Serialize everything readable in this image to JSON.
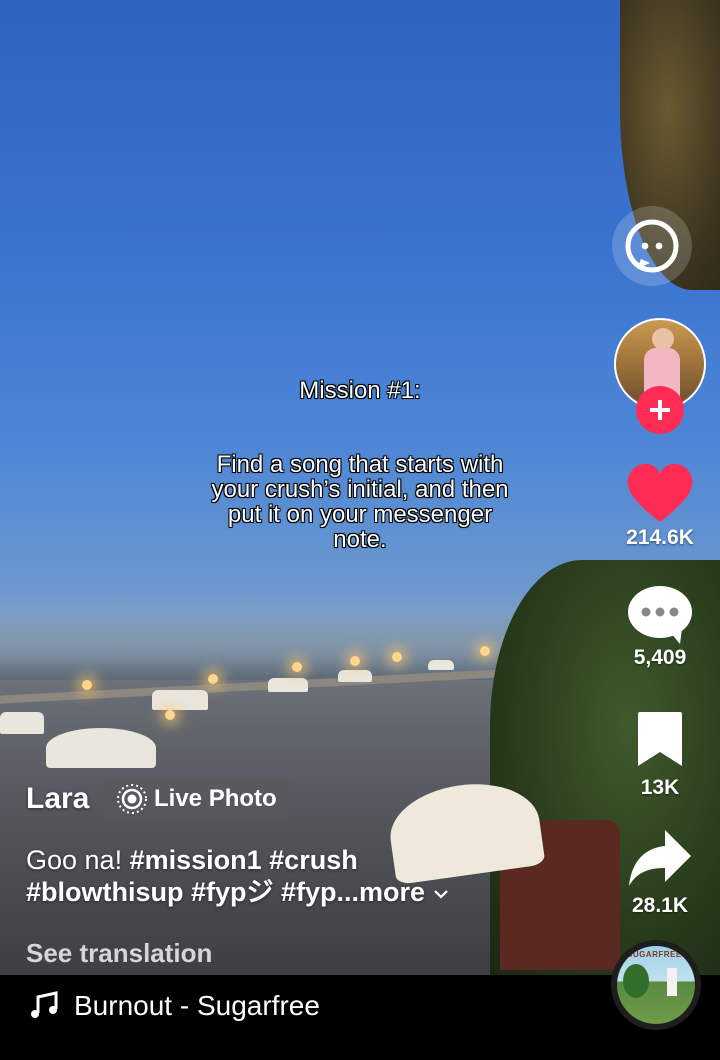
{
  "overlay": {
    "title": "Mission #1:",
    "body_lines": [
      "Find a song that starts with",
      "your crush’s initial, and then",
      "put it on your messenger",
      "note."
    ]
  },
  "actions": {
    "likes": "214.6K",
    "comments": "5,409",
    "saves": "13K",
    "shares": "28.1K"
  },
  "caption": {
    "username": "Lara",
    "badge": "Live Photo",
    "text": "Goo na!",
    "tags_line1": "#mission1 #crush",
    "tags_line2": "#blowthisup #fypジ #fyp",
    "more": "...more",
    "see_translation": "See translation"
  },
  "music": {
    "title": "Burnout - Sugarfree",
    "album_art_text": "SUGARFREE"
  },
  "colors": {
    "like": "#fe2c55",
    "follow": "#fe2c55"
  }
}
